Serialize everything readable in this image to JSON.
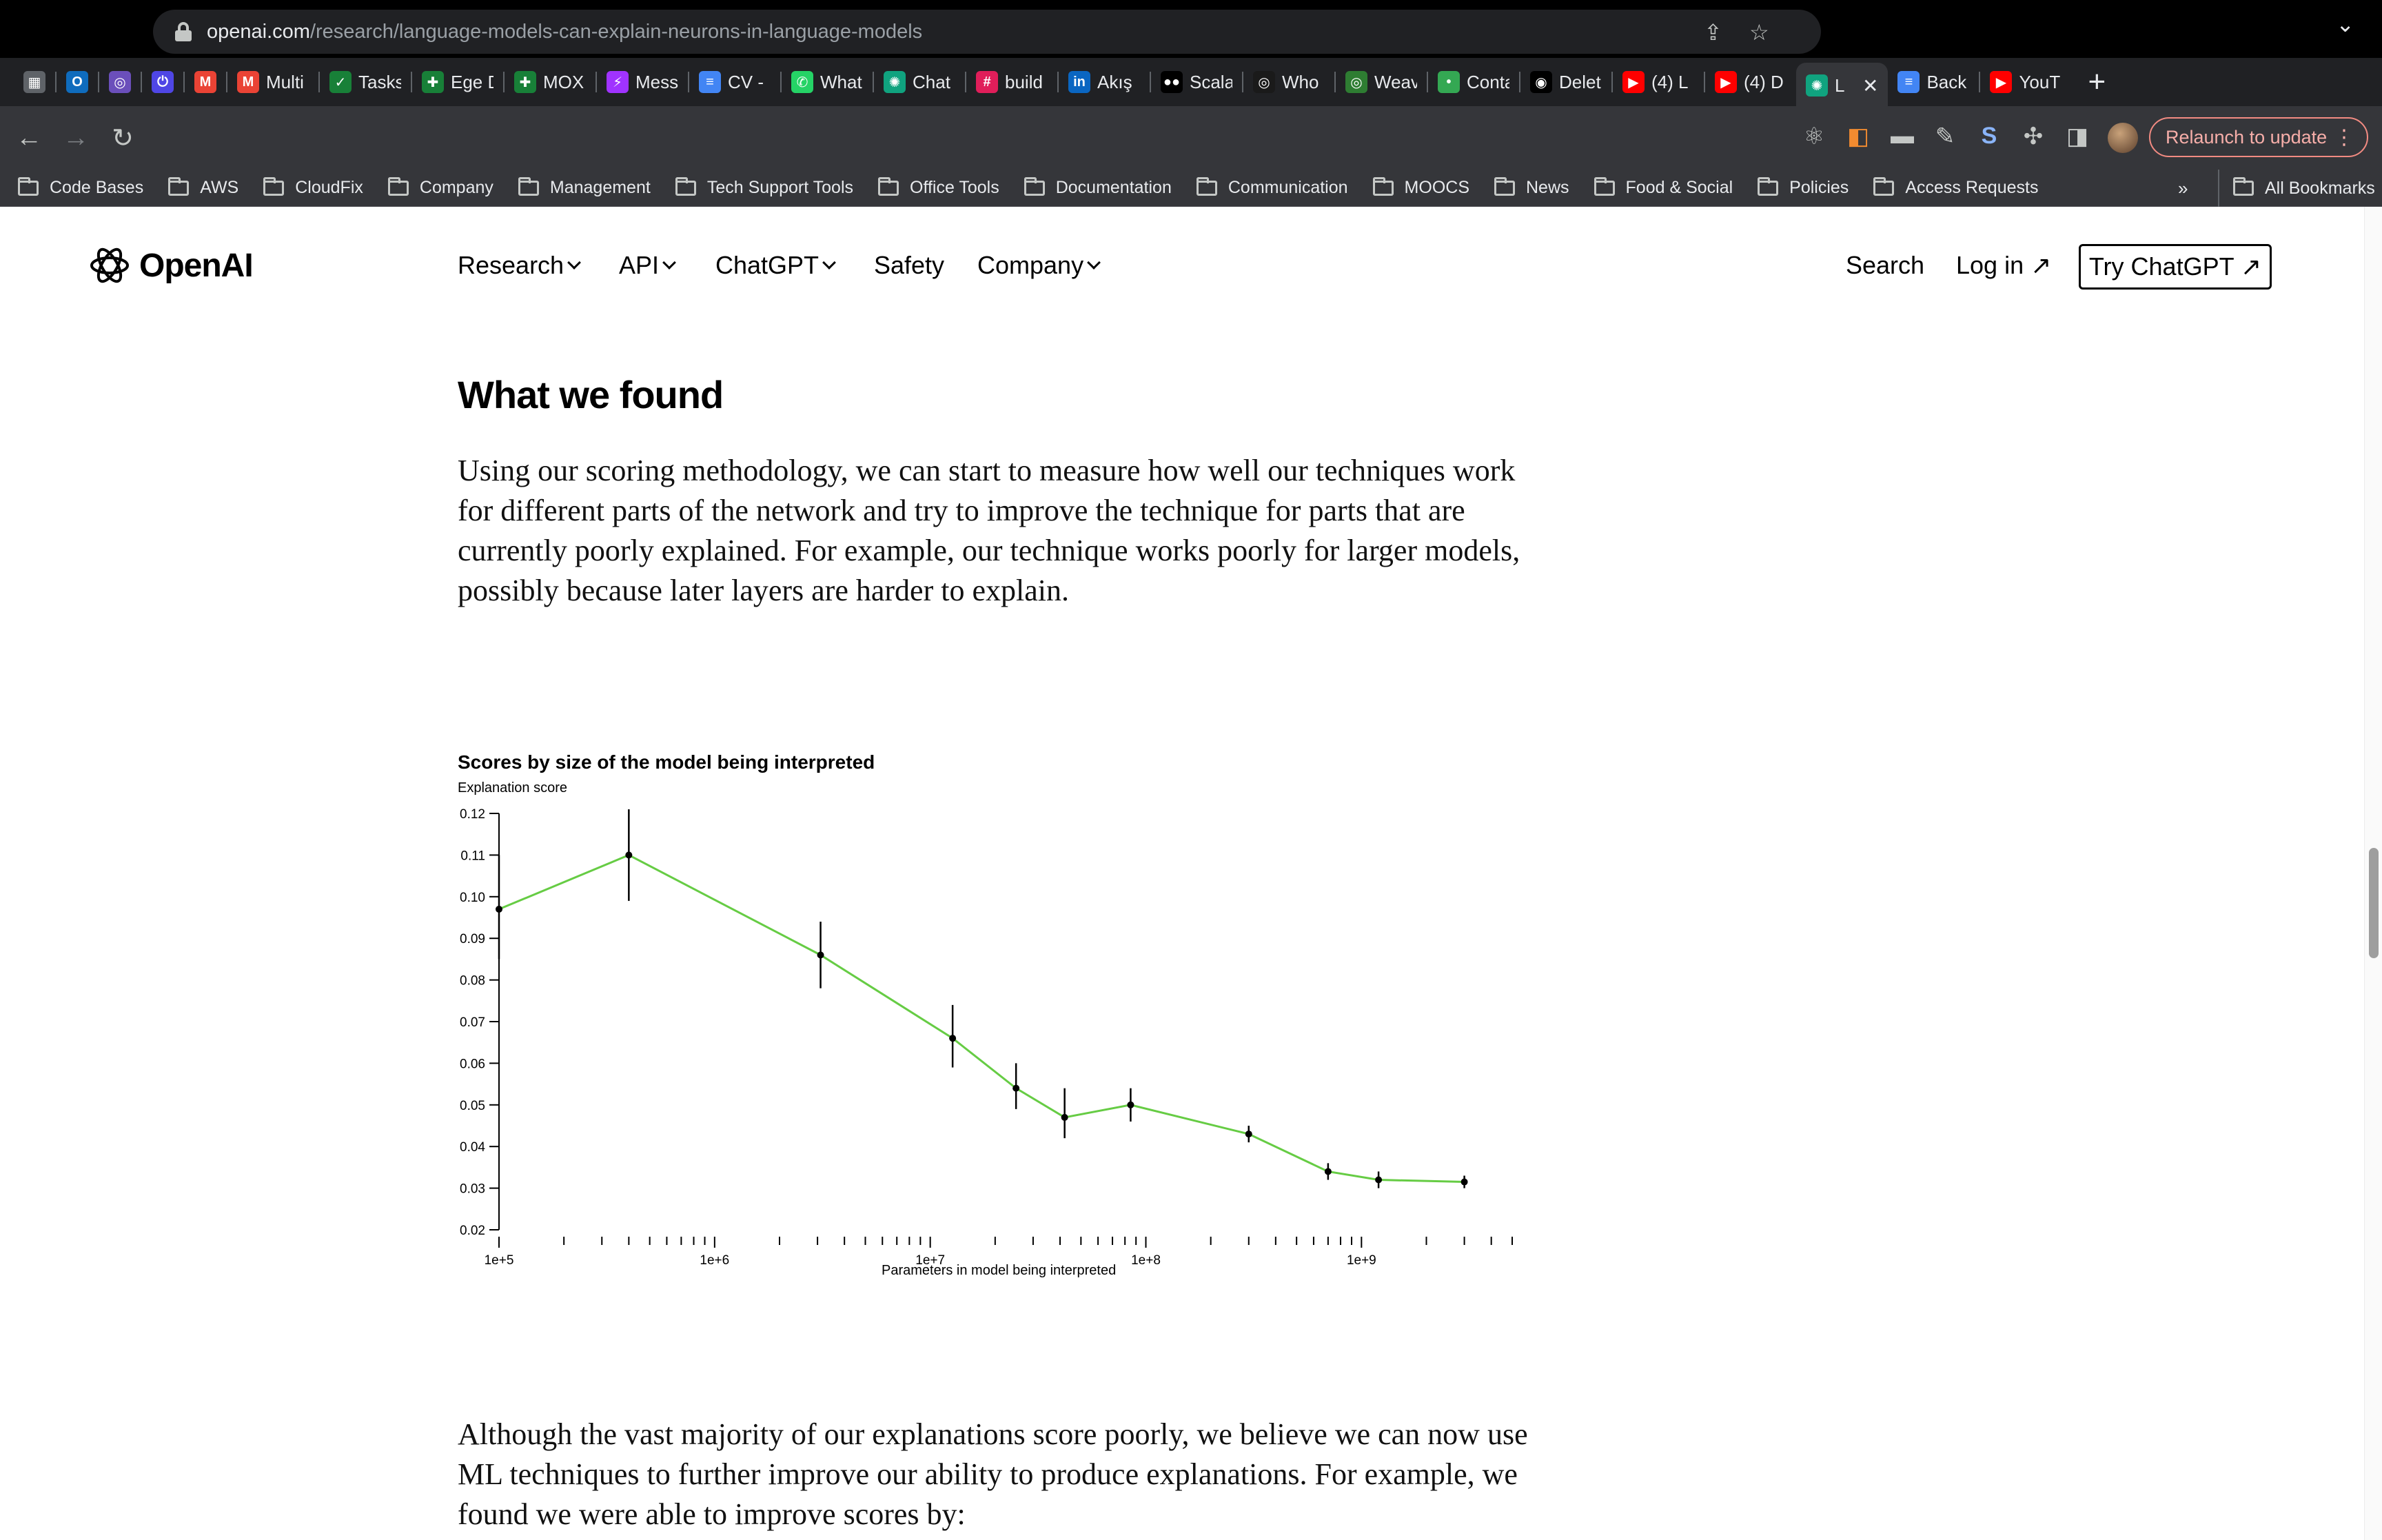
{
  "browser": {
    "tabs": [
      {
        "label": "",
        "icon": "grid-icon",
        "color": "#5f6368"
      },
      {
        "label": "",
        "icon": "outlook-icon",
        "color": "#0f6cbd"
      },
      {
        "label": "",
        "icon": "app-icon",
        "color": "#6b4fbb"
      },
      {
        "label": "",
        "icon": "power-icon",
        "color": "#4f46e5"
      },
      {
        "label": "",
        "icon": "gmail-icon",
        "color": "#ea4335"
      },
      {
        "label": "Multi",
        "icon": "gmail-icon",
        "color": "#ea4335"
      },
      {
        "label": "Tasks",
        "icon": "tasks-icon",
        "color": "#188038"
      },
      {
        "label": "Ege D",
        "icon": "sheets-icon",
        "color": "#188038"
      },
      {
        "label": "MOX",
        "icon": "sheets-icon",
        "color": "#188038"
      },
      {
        "label": "Mess",
        "icon": "messenger-icon",
        "color": "#a033ff"
      },
      {
        "label": "CV -",
        "icon": "docs-icon",
        "color": "#4285f4"
      },
      {
        "label": "What",
        "icon": "whatsapp-icon",
        "color": "#25d366"
      },
      {
        "label": "Chat",
        "icon": "chatgpt-icon",
        "color": "#10a37f"
      },
      {
        "label": "build",
        "icon": "slack-icon",
        "color": "#e01e5a"
      },
      {
        "label": "Akış",
        "icon": "linkedin-icon",
        "color": "#0a66c2"
      },
      {
        "label": "Scala",
        "icon": "medium-icon",
        "color": "#000000"
      },
      {
        "label": "Who",
        "icon": "app-icon",
        "color": "#1a1a1a"
      },
      {
        "label": "Weav",
        "icon": "app-icon",
        "color": "#2e7d32"
      },
      {
        "label": "Conta",
        "icon": "dot-icon",
        "color": "#34a853"
      },
      {
        "label": "Delet",
        "icon": "github-icon",
        "color": "#000000"
      },
      {
        "label": "(4) L",
        "icon": "youtube-icon",
        "color": "#ff0000"
      },
      {
        "label": "(4) D",
        "icon": "youtube-icon",
        "color": "#ff0000"
      },
      {
        "label": "L",
        "icon": "chatgpt-icon",
        "color": "#10a37f",
        "active": true
      },
      {
        "label": "Back",
        "icon": "docs-icon",
        "color": "#4285f4"
      },
      {
        "label": "YouT",
        "icon": "youtube-icon",
        "color": "#ff0000"
      }
    ],
    "url_host": "openai.com",
    "url_path": "/research/language-models-can-explain-neurons-in-language-models",
    "relaunch_label": "Relaunch to update",
    "bookmarks": [
      "Code Bases",
      "AWS",
      "CloudFix",
      "Company",
      "Management",
      "Tech Support Tools",
      "Office Tools",
      "Documentation",
      "Communication",
      "MOOCS",
      "News",
      "Food & Social",
      "Policies",
      "Access Requests"
    ],
    "bookmarks_more": "»",
    "all_bookmarks": "All Bookmarks"
  },
  "site": {
    "logo_text": "OpenAI",
    "nav": {
      "research": "Research",
      "api": "API",
      "chatgpt": "ChatGPT",
      "safety": "Safety",
      "company": "Company"
    },
    "search": "Search",
    "login": "Log in ↗",
    "try": "Try ChatGPT ↗"
  },
  "article": {
    "heading": "What we found",
    "para1": "Using our scoring methodology, we can start to measure how well our techniques work for different parts of the network and try to improve the technique for parts that are currently poorly explained. For example, our technique works poorly for larger models, possibly because later layers are harder to explain.",
    "para2": "Although the vast majority of our explanations score poorly, we believe we can now use ML techniques to further improve our ability to produce explanations. For example, we found we were able to improve scores by:"
  },
  "chart_data": {
    "type": "line",
    "title": "Scores by size of the model being interpreted",
    "ylabel": "Explanation score",
    "xlabel": "Parameters in model being interpreted",
    "x_scale": "log",
    "xlim": [
      100000,
      5000000000
    ],
    "ylim": [
      0.02,
      0.12
    ],
    "yticks": [
      0.02,
      0.03,
      0.04,
      0.05,
      0.06,
      0.07,
      0.08,
      0.09,
      0.1,
      0.11,
      0.12
    ],
    "ytick_labels": [
      "0.02",
      "0.03",
      "0.04",
      "0.05",
      "0.06",
      "0.07",
      "0.08",
      "0.09",
      "0.10",
      "0.11",
      "0.12"
    ],
    "xticks_major": [
      100000,
      1000000,
      10000000,
      100000000,
      1000000000
    ],
    "xtick_labels": [
      "1e+5",
      "1e+6",
      "1e+7",
      "1e+8",
      "1e+9"
    ],
    "line_color": "#66cc44",
    "series": [
      {
        "x": [
          100000,
          400000,
          3100000,
          12700000,
          25000000,
          42000000,
          85000000,
          300000000,
          700000000,
          1200000000,
          3000000000
        ],
        "y": [
          0.097,
          0.11,
          0.086,
          0.066,
          0.054,
          0.047,
          0.05,
          0.043,
          0.034,
          0.032,
          0.0315
        ],
        "err_low": [
          0.085,
          0.099,
          0.078,
          0.059,
          0.049,
          0.042,
          0.046,
          0.041,
          0.032,
          0.03,
          0.03
        ],
        "err_high": [
          0.11,
          0.121,
          0.094,
          0.074,
          0.06,
          0.054,
          0.054,
          0.045,
          0.036,
          0.034,
          0.033
        ]
      }
    ]
  }
}
